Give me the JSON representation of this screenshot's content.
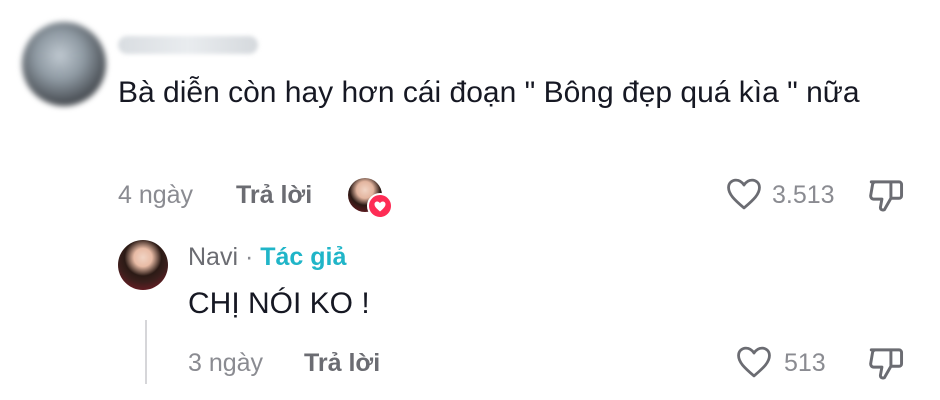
{
  "comment": {
    "text": "Bà diễn còn hay hơn cái đoạn \" Bông đẹp quá kìa \" nữa",
    "time": "4 ngày",
    "reply_label": "Trả lời",
    "like_count": "3.513"
  },
  "reply": {
    "author": "Navi",
    "separator": "·",
    "author_badge": "Tác giả",
    "text": "CHỊ NÓI KO !",
    "time": "3 ngày",
    "reply_label": "Trả lời",
    "like_count": "513"
  },
  "colors": {
    "author_badge": "#20b5c8",
    "heart": "#fe2c55",
    "text": "#161823",
    "muted": "#8a8b91"
  },
  "icons": [
    "heart-outline-icon",
    "thumbs-down-icon",
    "creator-liked-heart-icon"
  ]
}
